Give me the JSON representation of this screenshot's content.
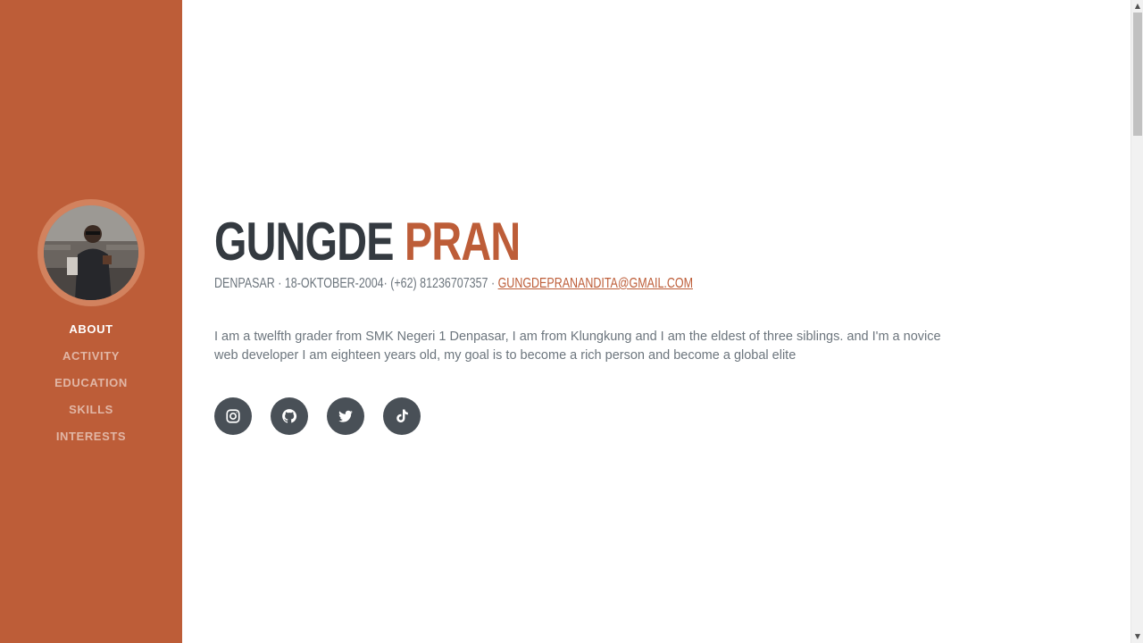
{
  "sidebar": {
    "avatar_alt": "profile photo",
    "nav": [
      {
        "label": "About",
        "active": true
      },
      {
        "label": "Activity",
        "active": false
      },
      {
        "label": "Education",
        "active": false
      },
      {
        "label": "Skills",
        "active": false
      },
      {
        "label": "Interests",
        "active": false
      }
    ]
  },
  "about": {
    "first_name": "GUNGDE",
    "last_name": "PRAN",
    "subheading_text": "DENPASAR · 18-OKTOBER-2004· (+62) 81236707357 · ",
    "email": "GUNGDEPRANANDITA@GMAIL.COM",
    "description": "I am a twelfth grader from SMK Negeri 1 Denpasar, I am from Klungkung and I am the eldest of three siblings. and I'm a novice web developer I am eighteen years old, my goal is to become a rich person and become a global elite"
  },
  "social": [
    {
      "name": "instagram-icon"
    },
    {
      "name": "github-icon"
    },
    {
      "name": "twitter-icon"
    },
    {
      "name": "tiktok-icon"
    }
  ],
  "colors": {
    "primary": "#bd5d38",
    "heading": "#343a40",
    "muted": "#6c757d",
    "social_bg": "#495057"
  }
}
